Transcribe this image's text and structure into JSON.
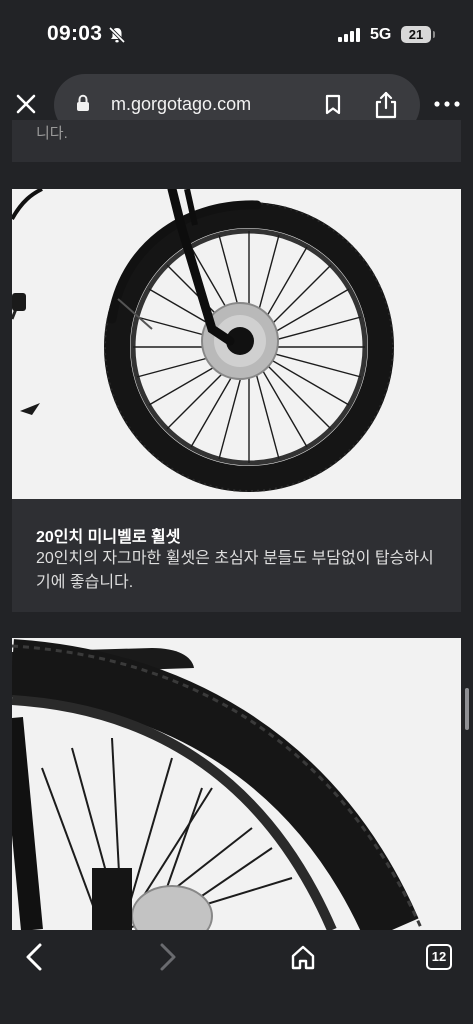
{
  "status_bar": {
    "time": "09:03",
    "network": "5G",
    "battery": "21"
  },
  "browser": {
    "url": "m.gorgotago.com",
    "tab_count": "12"
  },
  "content": {
    "cards": [
      {
        "title": "20인치 미니벨로 휠셋",
        "description": "20인치의 자그마한 휠셋은 초심자 분들도 부담없이 탑승하시기에 좋습니다."
      }
    ]
  },
  "colors": {
    "page_bg": "#222326",
    "card_bg": "#2e2f33",
    "image_bg": "#f2f2f2"
  },
  "icons": [
    "bell-slash-icon",
    "signal-icon",
    "battery-icon",
    "close-icon",
    "lock-icon",
    "bookmark-icon",
    "share-icon",
    "more-icon",
    "back-icon",
    "forward-icon",
    "home-icon",
    "tabs-icon"
  ]
}
